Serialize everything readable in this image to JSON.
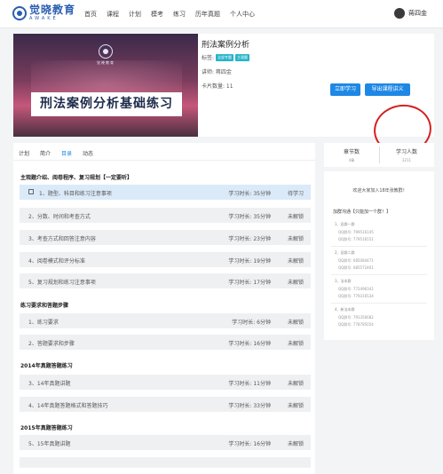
{
  "nav": {
    "logo_cn": "觉晓教育",
    "logo_en": "AWAKE",
    "items": [
      "首页",
      "课程",
      "计划",
      "模考",
      "练习",
      "历年真题",
      "个人中心"
    ],
    "user_name": "蒋四金"
  },
  "course": {
    "cover_small_text": "觉晓教育",
    "cover_title": "刑法案例分析基础练习",
    "title": "刑法案例分析",
    "tags_label": "标签:",
    "tags": [
      "全部专题",
      "主观题"
    ],
    "teacher": "讲师: 蒋四金",
    "cards": "卡片数量: 11",
    "btn_study": "立即学习",
    "btn_export": "导出课程讲义"
  },
  "tabs": [
    "计划",
    "简介",
    "目录",
    "动态"
  ],
  "active_tab": "目录",
  "sections": [
    {
      "title": "主观题介绍、阅卷程序、复习规划【一定要听】",
      "rows": [
        {
          "title": "1、题型、科目和练习注意事项",
          "duration": "学习时长: 35分钟",
          "status": "待学习",
          "active": true
        },
        {
          "title": "2、分数、时间和考查方式",
          "duration": "学习时长: 35分钟",
          "status": "未解锁"
        },
        {
          "title": "3、考查方式和回答注意内容",
          "duration": "学习时长: 23分钟",
          "status": "未解锁"
        },
        {
          "title": "4、阅卷模式和评分标准",
          "duration": "学习时长: 19分钟",
          "status": "未解锁"
        },
        {
          "title": "5、复习规划和练习注意事项",
          "duration": "学习时长: 17分钟",
          "status": "未解锁"
        }
      ]
    },
    {
      "title": "练习要求和答题步骤",
      "rows": [
        {
          "title": "1、练习要求",
          "duration": "学习时长: 6分钟",
          "status": "未解锁"
        },
        {
          "title": "2、答题要求和步骤",
          "duration": "学习时长: 16分钟",
          "status": "未解锁"
        }
      ]
    },
    {
      "title": "2014年真题答题练习",
      "rows": [
        {
          "title": "3、14年真题讲题",
          "duration": "学习时长: 11分钟",
          "status": "未解锁"
        },
        {
          "title": "4、14年真题答题格式和答题技巧",
          "duration": "学习时长: 33分钟",
          "status": "未解锁"
        }
      ]
    },
    {
      "title": "2015年真题答题练习",
      "rows": [
        {
          "title": "5、15年真题讲题",
          "duration": "学习时长: 16分钟",
          "status": "未解锁"
        }
      ]
    }
  ],
  "stats": {
    "chapters_label": "章节数",
    "chapters_value": "4章",
    "learners_label": "学习人数",
    "learners_value": "3211"
  },
  "groups": {
    "welcome": "欢迎大家加入18年张教群！",
    "join_title": "加群沟通【只能加一个群！】",
    "entries": [
      {
        "name": "1、旧群一群",
        "lines": [
          "QQ群号: 799516145",
          "QQ群号: 779516551"
        ]
      },
      {
        "name": "2、旧群二群",
        "lines": [
          "QQ群号: 685084471",
          "QQ群号: 685572461"
        ]
      },
      {
        "name": "3、法本群",
        "lines": [
          "QQ群号: 772496341",
          "QQ群号: 779316534"
        ]
      },
      {
        "name": "4、新法本群",
        "lines": [
          "QQ群号: 791356682",
          "QQ群号: 778785054"
        ]
      }
    ]
  }
}
